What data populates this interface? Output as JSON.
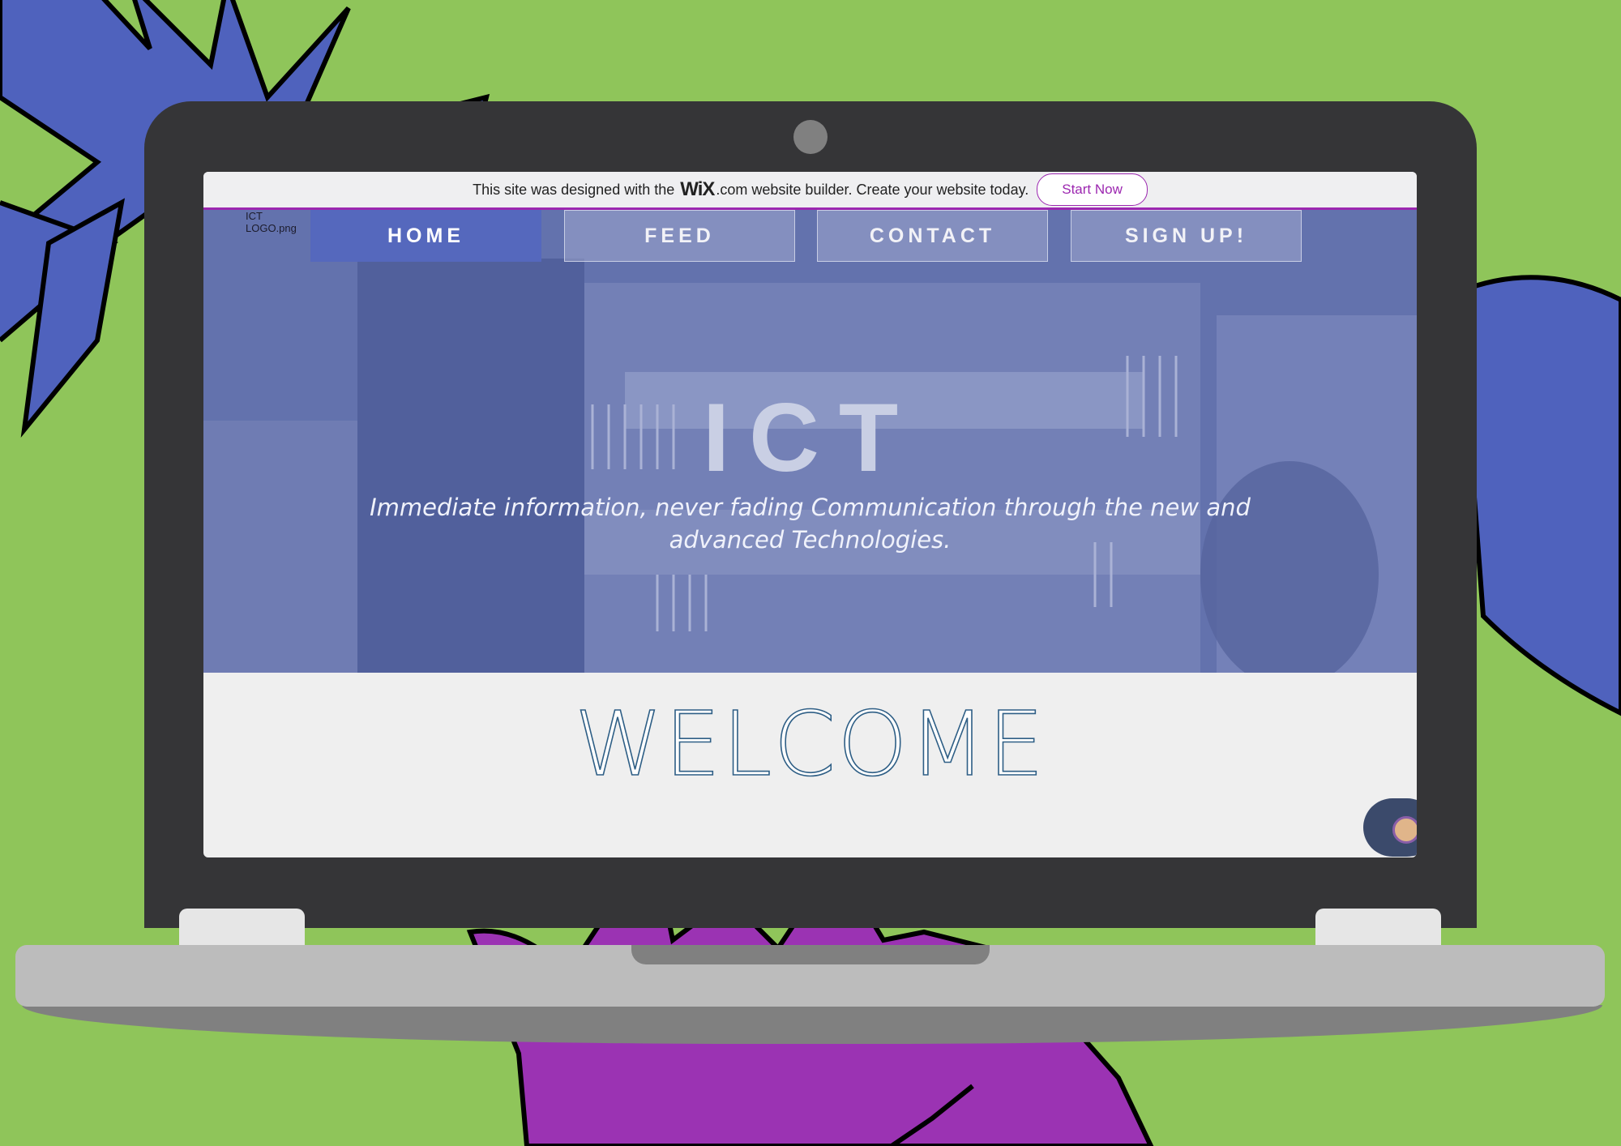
{
  "wix_banner": {
    "text_before": "This site was designed with the",
    "logo": "WiX",
    "text_after": ".com website builder. Create your website today.",
    "button_label": "Start Now"
  },
  "site": {
    "logo_alt": "ICT LOGO.png",
    "nav": [
      {
        "label": "HOME"
      },
      {
        "label": "FEED"
      },
      {
        "label": "CONTACT"
      },
      {
        "label": "SIGN UP!"
      }
    ],
    "hero_title": "ICT",
    "hero_subtitle": "Immediate information, never fading Communication through the new and advanced Technologies.",
    "welcome": "WELCOME"
  },
  "colors": {
    "background": "#8fc55a",
    "laptop": "#353537",
    "accent": "#9c27b0",
    "nav_active": "#5568bd",
    "hero_overlay": "#6a77ad"
  },
  "icons": [
    "camera-icon",
    "chat-widget-icon"
  ]
}
